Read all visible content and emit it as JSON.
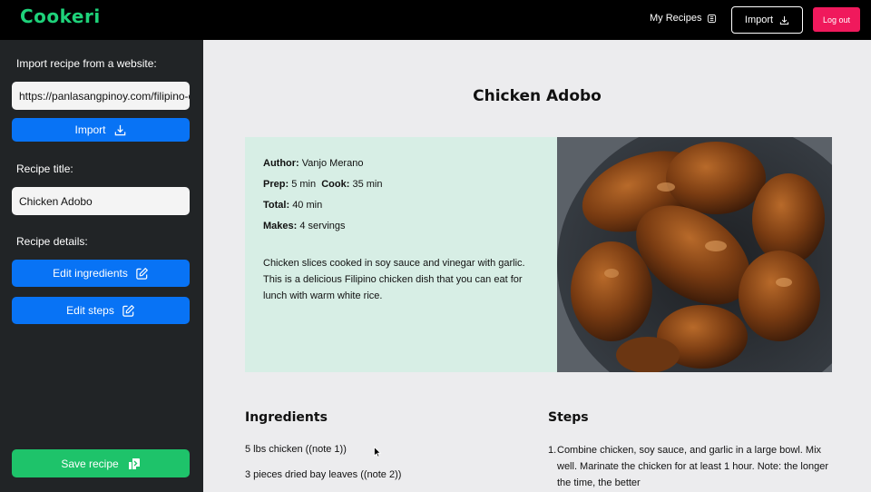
{
  "app": {
    "logo": "Cookeri"
  },
  "topnav": {
    "my_recipes": "My Recipes",
    "import": "Import",
    "logout": "Log out"
  },
  "sidebar": {
    "import_label": "Import recipe from a website:",
    "url_value": "https://panlasangpinoy.com/filipino-chi",
    "import_button": "Import",
    "title_label": "Recipe title:",
    "title_value": "Chicken Adobo",
    "details_label": "Recipe details:",
    "edit_ingredients": "Edit ingredients",
    "edit_steps": "Edit steps",
    "save_button": "Save recipe"
  },
  "recipe": {
    "title": "Chicken Adobo",
    "author_label": "Author:",
    "author": "Vanjo Merano",
    "prep_label": "Prep:",
    "prep": "5 min",
    "cook_label": "Cook:",
    "cook": "35 min",
    "total_label": "Total:",
    "total": "40 min",
    "makes_label": "Makes:",
    "makes": "4 servings",
    "description": "Chicken slices cooked in soy sauce and vinegar with garlic. This is a delicious Filipino chicken dish that you can eat for lunch with warm white rice.",
    "ingredients_heading": "Ingredients",
    "ingredients": [
      "5 lbs chicken ((note 1))",
      "3 pieces dried bay leaves ((note 2))"
    ],
    "steps_heading": "Steps",
    "steps": [
      {
        "num": "1.",
        "text": "Combine chicken, soy sauce, and garlic in a large bowl. Mix well. Marinate the chicken for at least 1 hour. Note: the longer the time, the better"
      }
    ]
  },
  "colors": {
    "brand_green": "#1ed27a",
    "primary_blue": "#0873f5",
    "save_green": "#1ec36a",
    "logout_pink": "#f0195c",
    "info_panel_bg": "#d7eee5"
  }
}
